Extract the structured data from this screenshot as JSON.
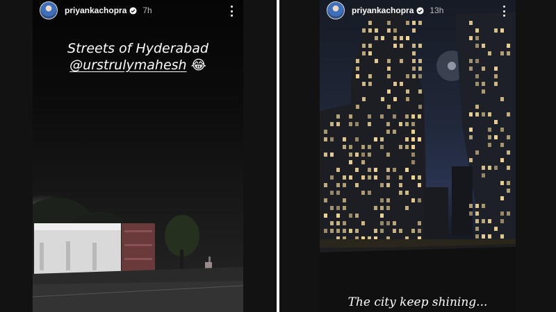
{
  "stories": [
    {
      "username": "priyankachopra",
      "time": "7h",
      "caption_line1": "Streets of Hyderabad",
      "mention": "@urstrulymahesh",
      "emoji": "😂"
    },
    {
      "username": "priyankachopra",
      "time": "13h",
      "caption": "The city keep shining..."
    }
  ],
  "icons": {
    "verified": "verified-badge-icon",
    "more": "more-options-icon",
    "avatar": "profile-avatar"
  },
  "colors": {
    "text": "#ffffff",
    "time": "#bdbdbd",
    "divider": "#f2f2f2"
  }
}
